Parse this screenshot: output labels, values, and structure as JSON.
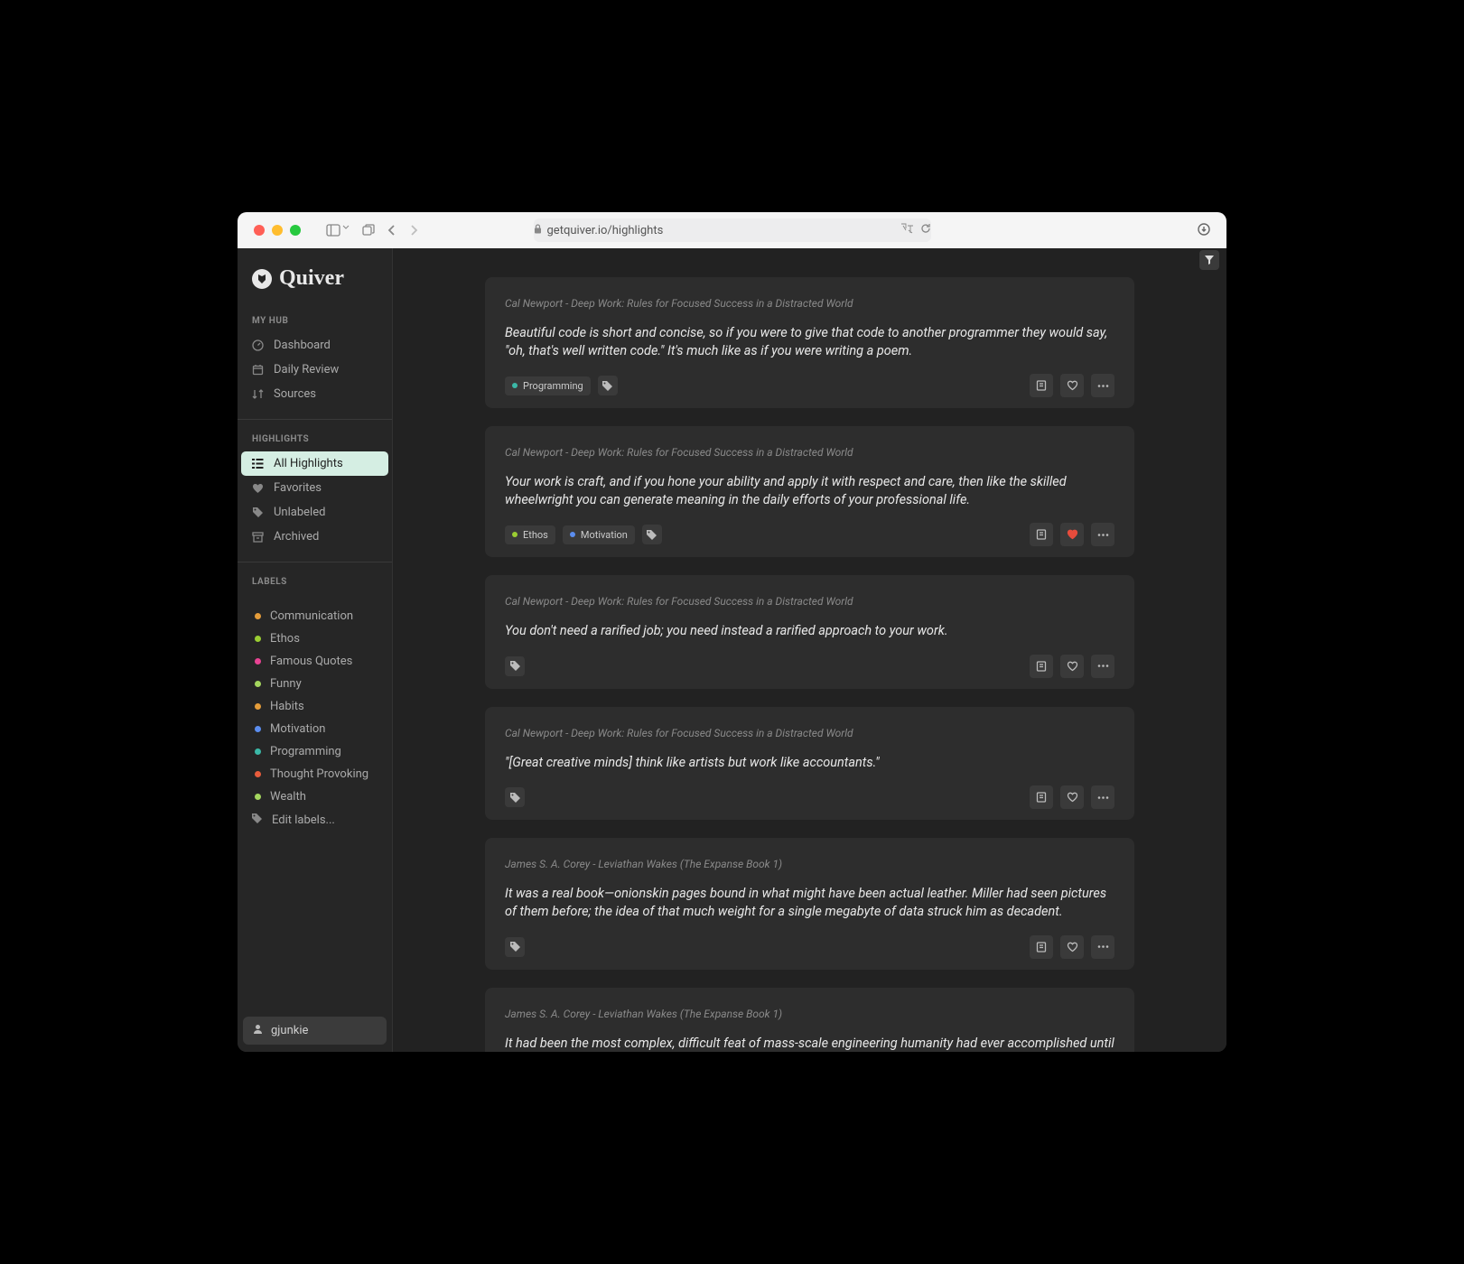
{
  "browser": {
    "url": "getquiver.io/highlights"
  },
  "app_name": "Quiver",
  "sidebar": {
    "section1_label": "MY HUB",
    "hub": [
      {
        "icon": "gauge",
        "label": "Dashboard"
      },
      {
        "icon": "calendar",
        "label": "Daily Review"
      },
      {
        "icon": "sort",
        "label": "Sources"
      }
    ],
    "section2_label": "HIGHLIGHTS",
    "highlights": [
      {
        "icon": "list",
        "label": "All Highlights",
        "active": true
      },
      {
        "icon": "heart",
        "label": "Favorites"
      },
      {
        "icon": "tag",
        "label": "Unlabeled"
      },
      {
        "icon": "archive",
        "label": "Archived"
      }
    ],
    "section3_label": "LABELS",
    "labels": [
      {
        "color": "#e59d3a",
        "name": "Communication"
      },
      {
        "color": "#9acd32",
        "name": "Ethos"
      },
      {
        "color": "#e84393",
        "name": "Famous Quotes"
      },
      {
        "color": "#a4d65e",
        "name": "Funny"
      },
      {
        "color": "#e59d3a",
        "name": "Habits"
      },
      {
        "color": "#5b8def",
        "name": "Motivation"
      },
      {
        "color": "#3bb8a7",
        "name": "Programming"
      },
      {
        "color": "#e85c3c",
        "name": "Thought Provoking"
      },
      {
        "color": "#a4d65e",
        "name": "Wealth"
      }
    ],
    "edit_labels": "Edit labels...",
    "user": "gjunkie"
  },
  "highlights": [
    {
      "source": "Cal Newport - Deep Work: Rules for Focused Success in a Distracted World",
      "text": "Beautiful code is short and concise, so if you were to give that code to another programmer they would say, \"oh, that's well written code.\" It's much like as if you were writing a poem.",
      "tags": [
        {
          "name": "Programming",
          "color": "#3bb8a7"
        }
      ],
      "favorited": false
    },
    {
      "source": "Cal Newport - Deep Work: Rules for Focused Success in a Distracted World",
      "text": "Your work is craft, and if you hone your ability and apply it with respect and care, then like the skilled wheelwright you can generate meaning in the daily efforts of your professional life.",
      "tags": [
        {
          "name": "Ethos",
          "color": "#9acd32"
        },
        {
          "name": "Motivation",
          "color": "#5b8def"
        }
      ],
      "favorited": true
    },
    {
      "source": "Cal Newport - Deep Work: Rules for Focused Success in a Distracted World",
      "text": "You don't need a rarified job; you need instead a rarified approach to your work.",
      "tags": [],
      "favorited": false
    },
    {
      "source": "Cal Newport - Deep Work: Rules for Focused Success in a Distracted World",
      "text": "\"[Great creative minds] think like artists but work like accountants.\"",
      "tags": [],
      "favorited": false
    },
    {
      "source": "James S. A. Corey - Leviathan Wakes (The Expanse Book 1)",
      "text": "It was a real book—onionskin pages bound in what might have been actual leather. Miller had seen pictures of them before; the idea of that much weight for a single megabyte of data struck him as decadent.",
      "tags": [],
      "favorited": false
    },
    {
      "source": "James S. A. Corey - Leviathan Wakes (The Expanse Book 1)",
      "text": "It had been the most complex, difficult feat of mass-scale engineering humanity had ever accomplished until the next thing they did.",
      "tags": [],
      "favorited": false
    }
  ]
}
